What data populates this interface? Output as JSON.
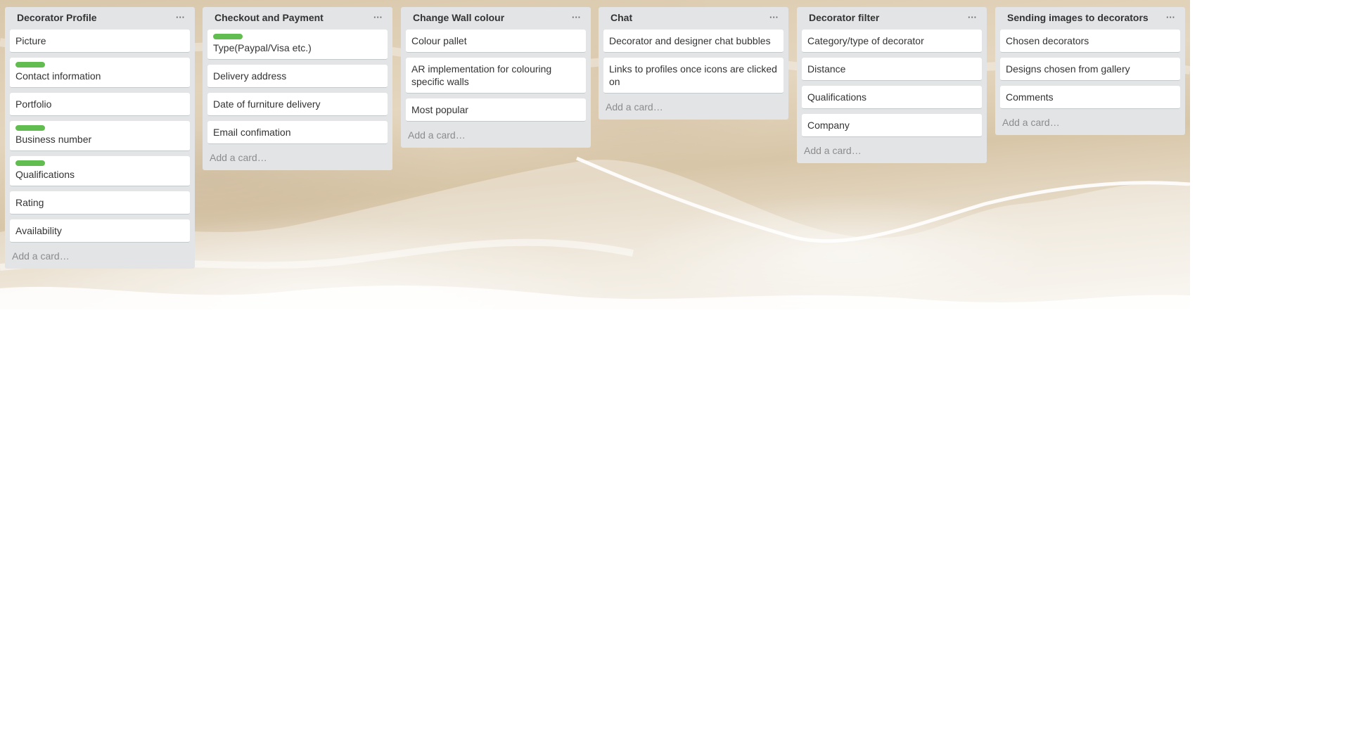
{
  "colors": {
    "label_green": "#61bd4f",
    "list_bg": "#e2e4e6",
    "card_bg": "#ffffff"
  },
  "add_card_label": "Add a card…",
  "menu_glyph": "···",
  "lists": [
    {
      "title": "Decorator Profile",
      "cards": [
        {
          "text": "Picture",
          "label": null
        },
        {
          "text": "Contact information",
          "label": "green"
        },
        {
          "text": "Portfolio",
          "label": null
        },
        {
          "text": "Business number",
          "label": "green"
        },
        {
          "text": "Qualifications",
          "label": "green"
        },
        {
          "text": "Rating",
          "label": null
        },
        {
          "text": "Availability",
          "label": null
        }
      ]
    },
    {
      "title": "Checkout and Payment",
      "cards": [
        {
          "text": "Type(Paypal/Visa etc.)",
          "label": "green"
        },
        {
          "text": "Delivery address",
          "label": null
        },
        {
          "text": "Date of furniture delivery",
          "label": null
        },
        {
          "text": "Email confimation",
          "label": null
        }
      ]
    },
    {
      "title": "Change Wall colour",
      "cards": [
        {
          "text": "Colour pallet",
          "label": null
        },
        {
          "text": "AR implementation for colouring specific walls",
          "label": null
        },
        {
          "text": "Most popular",
          "label": null
        }
      ]
    },
    {
      "title": "Chat",
      "cards": [
        {
          "text": "Decorator and designer chat bubbles",
          "label": null
        },
        {
          "text": "Links to profiles once icons are clicked on",
          "label": null
        }
      ]
    },
    {
      "title": "Decorator filter",
      "cards": [
        {
          "text": "Category/type of decorator",
          "label": null
        },
        {
          "text": "Distance",
          "label": null
        },
        {
          "text": "Qualifications",
          "label": null
        },
        {
          "text": "Company",
          "label": null
        }
      ]
    },
    {
      "title": "Sending images to decorators",
      "cards": [
        {
          "text": "Chosen decorators",
          "label": null
        },
        {
          "text": "Designs chosen from gallery",
          "label": null
        },
        {
          "text": "Comments",
          "label": null
        }
      ]
    }
  ]
}
